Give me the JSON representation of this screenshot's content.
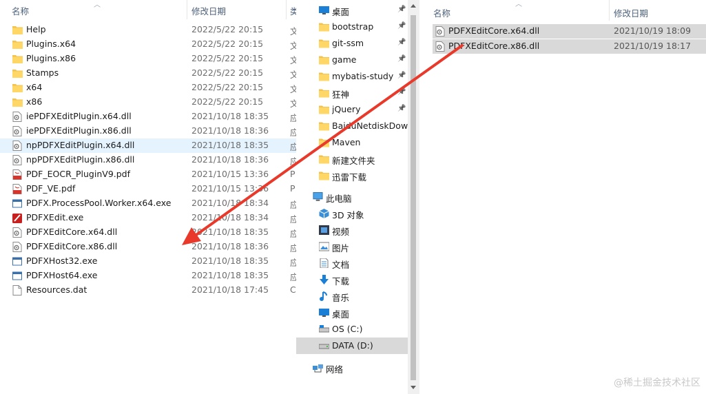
{
  "left_pane": {
    "header": {
      "name": "名称",
      "date": "修改日期",
      "type": "类"
    },
    "files": [
      {
        "name": "Help",
        "date": "2022/5/22 20:15",
        "type": "文",
        "icon": "folder-icon"
      },
      {
        "name": "Plugins.x64",
        "date": "2022/5/22 20:15",
        "type": "文",
        "icon": "folder-icon"
      },
      {
        "name": "Plugins.x86",
        "date": "2022/5/22 20:15",
        "type": "文",
        "icon": "folder-icon"
      },
      {
        "name": "Stamps",
        "date": "2022/5/22 20:15",
        "type": "文",
        "icon": "folder-icon"
      },
      {
        "name": "x64",
        "date": "2022/5/22 20:15",
        "type": "文",
        "icon": "folder-icon"
      },
      {
        "name": "x86",
        "date": "2022/5/22 20:15",
        "type": "文",
        "icon": "folder-icon"
      },
      {
        "name": "iePDFXEditPlugin.x64.dll",
        "date": "2021/10/18 18:35",
        "type": "应",
        "icon": "dll-file-icon"
      },
      {
        "name": "iePDFXEditPlugin.x86.dll",
        "date": "2021/10/18 18:36",
        "type": "应",
        "icon": "dll-file-icon"
      },
      {
        "name": "npPDFXEditPlugin.x64.dll",
        "date": "2021/10/18 18:35",
        "type": "应",
        "icon": "dll-file-icon"
      },
      {
        "name": "npPDFXEditPlugin.x86.dll",
        "date": "2021/10/18 18:36",
        "type": "应",
        "icon": "dll-file-icon"
      },
      {
        "name": "PDF_EOCR_PluginV9.pdf",
        "date": "2021/10/15 13:36",
        "type": "P",
        "icon": "pdf-file-icon"
      },
      {
        "name": "PDF_VE.pdf",
        "date": "2021/10/15 13:36",
        "type": "P",
        "icon": "pdf-file-icon"
      },
      {
        "name": "PDFX.ProcessPool.Worker.x64.exe",
        "date": "2021/10/18 18:34",
        "type": "应",
        "icon": "exe-window-icon"
      },
      {
        "name": "PDFXEdit.exe",
        "date": "2021/10/18 18:34",
        "type": "应",
        "icon": "pdfxedit-app-icon"
      },
      {
        "name": "PDFXEditCore.x64.dll",
        "date": "2021/10/18 18:35",
        "type": "应",
        "icon": "dll-file-icon"
      },
      {
        "name": "PDFXEditCore.x86.dll",
        "date": "2021/10/18 18:36",
        "type": "应",
        "icon": "dll-file-icon"
      },
      {
        "name": "PDFXHost32.exe",
        "date": "2021/10/18 18:35",
        "type": "应",
        "icon": "exe-window-icon"
      },
      {
        "name": "PDFXHost64.exe",
        "date": "2021/10/18 18:35",
        "type": "应",
        "icon": "exe-window-icon"
      },
      {
        "name": "Resources.dat",
        "date": "2021/10/18 17:45",
        "type": "C",
        "icon": "blank-file-icon"
      }
    ],
    "hover_row_index": 8
  },
  "nav_pane": {
    "quick_access": [
      {
        "label": "桌面",
        "icon": "desktop-icon",
        "pinned": true
      },
      {
        "label": "bootstrap",
        "icon": "folder-icon",
        "pinned": true
      },
      {
        "label": "git-ssm",
        "icon": "folder-icon",
        "pinned": true
      },
      {
        "label": "game",
        "icon": "folder-icon",
        "pinned": true
      },
      {
        "label": "mybatis-study",
        "icon": "folder-icon",
        "pinned": true
      },
      {
        "label": "狂神",
        "icon": "folder-icon",
        "pinned": true
      },
      {
        "label": "jQuery",
        "icon": "folder-icon",
        "pinned": true
      },
      {
        "label": "BaiduNetdiskDownload",
        "icon": "folder-icon",
        "pinned": false
      },
      {
        "label": "Maven",
        "icon": "folder-icon",
        "pinned": false
      },
      {
        "label": "新建文件夹",
        "icon": "folder-icon",
        "pinned": false
      },
      {
        "label": "迅雷下载",
        "icon": "folder-icon",
        "pinned": false
      }
    ],
    "this_pc": {
      "label": "此电脑",
      "icon": "computer-icon"
    },
    "pc_items": [
      {
        "label": "3D 对象",
        "icon": "3d-objects-icon"
      },
      {
        "label": "视频",
        "icon": "video-icon"
      },
      {
        "label": "图片",
        "icon": "pictures-icon"
      },
      {
        "label": "文档",
        "icon": "documents-icon"
      },
      {
        "label": "下载",
        "icon": "download-arrow-icon"
      },
      {
        "label": "音乐",
        "icon": "music-note-icon"
      },
      {
        "label": "桌面",
        "icon": "desktop-icon"
      },
      {
        "label": "OS (C:)",
        "icon": "drive-c-icon"
      },
      {
        "label": "DATA (D:)",
        "icon": "drive-d-icon",
        "selected": true
      }
    ],
    "network": {
      "label": "网络",
      "icon": "network-icon"
    }
  },
  "right_pane": {
    "header": {
      "name": "名称",
      "date": "修改日期"
    },
    "files": [
      {
        "name": "PDFXEditCore.x64.dll",
        "date": "2021/10/19 18:09",
        "icon": "dll-file-icon"
      },
      {
        "name": "PDFXEditCore.x86.dll",
        "date": "2021/10/19 18:17",
        "icon": "dll-file-icon"
      }
    ]
  },
  "annotation": {
    "arrow_color": "#e8392b"
  },
  "watermark": "@稀土掘金技术社区"
}
